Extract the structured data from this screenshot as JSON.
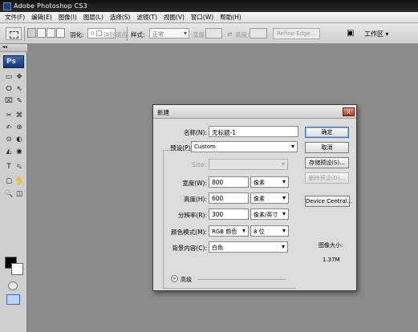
{
  "app": {
    "title": "Adobe Photoshop CS3"
  },
  "menu": [
    "文件(F)",
    "编辑(E)",
    "图像(I)",
    "图层(L)",
    "选择(S)",
    "滤镜(T)",
    "视图(V)",
    "窗口(W)",
    "帮助(H)"
  ],
  "options_bar": {
    "feather_label": "羽化:",
    "feather_value": "0 px",
    "antialias_label": "消除锯齿",
    "style_label": "样式:",
    "style_value": "正常",
    "width_label": "宽度:",
    "height_label": "高度:",
    "refine_edge": "Refine Edge...",
    "workspace_label": "工作区 ▾"
  },
  "toolbox": {
    "logo": "Ps",
    "tools": [
      "▭",
      "✥",
      "ⵔ",
      "⇖",
      "⌧",
      "✎",
      "✂",
      "⌘",
      "✍",
      "⊛",
      "⊙",
      "◐",
      "◭",
      "◉",
      "T",
      "⬁",
      "▢",
      "✋",
      "🔍",
      "◫"
    ]
  },
  "dialog": {
    "title": "新建",
    "close": "x",
    "name_label": "名称(N):",
    "name_value": "无标题-1",
    "preset_label": "预设(P):",
    "preset_value": "Custom",
    "size_label": "Size:",
    "width_label": "宽度(W):",
    "width_value": "800",
    "width_unit": "像素",
    "height_label": "高度(H):",
    "height_value": "600",
    "height_unit": "像素",
    "resolution_label": "分辨率(R):",
    "resolution_value": "300",
    "resolution_unit": "像素/英寸",
    "color_mode_label": "颜色模式(M):",
    "color_mode_value": "RGB 颜色",
    "bit_depth_value": "8 位",
    "background_label": "背景内容(C):",
    "background_value": "白色",
    "advanced_label": "高级",
    "buttons": {
      "ok": "确定",
      "cancel": "取消",
      "save_preset": "存储预设(S)...",
      "delete_preset": "删除预设(D)...",
      "device_central": "Device Central..."
    },
    "image_size_label": "图像大小:",
    "image_size_value": "1.37M"
  }
}
